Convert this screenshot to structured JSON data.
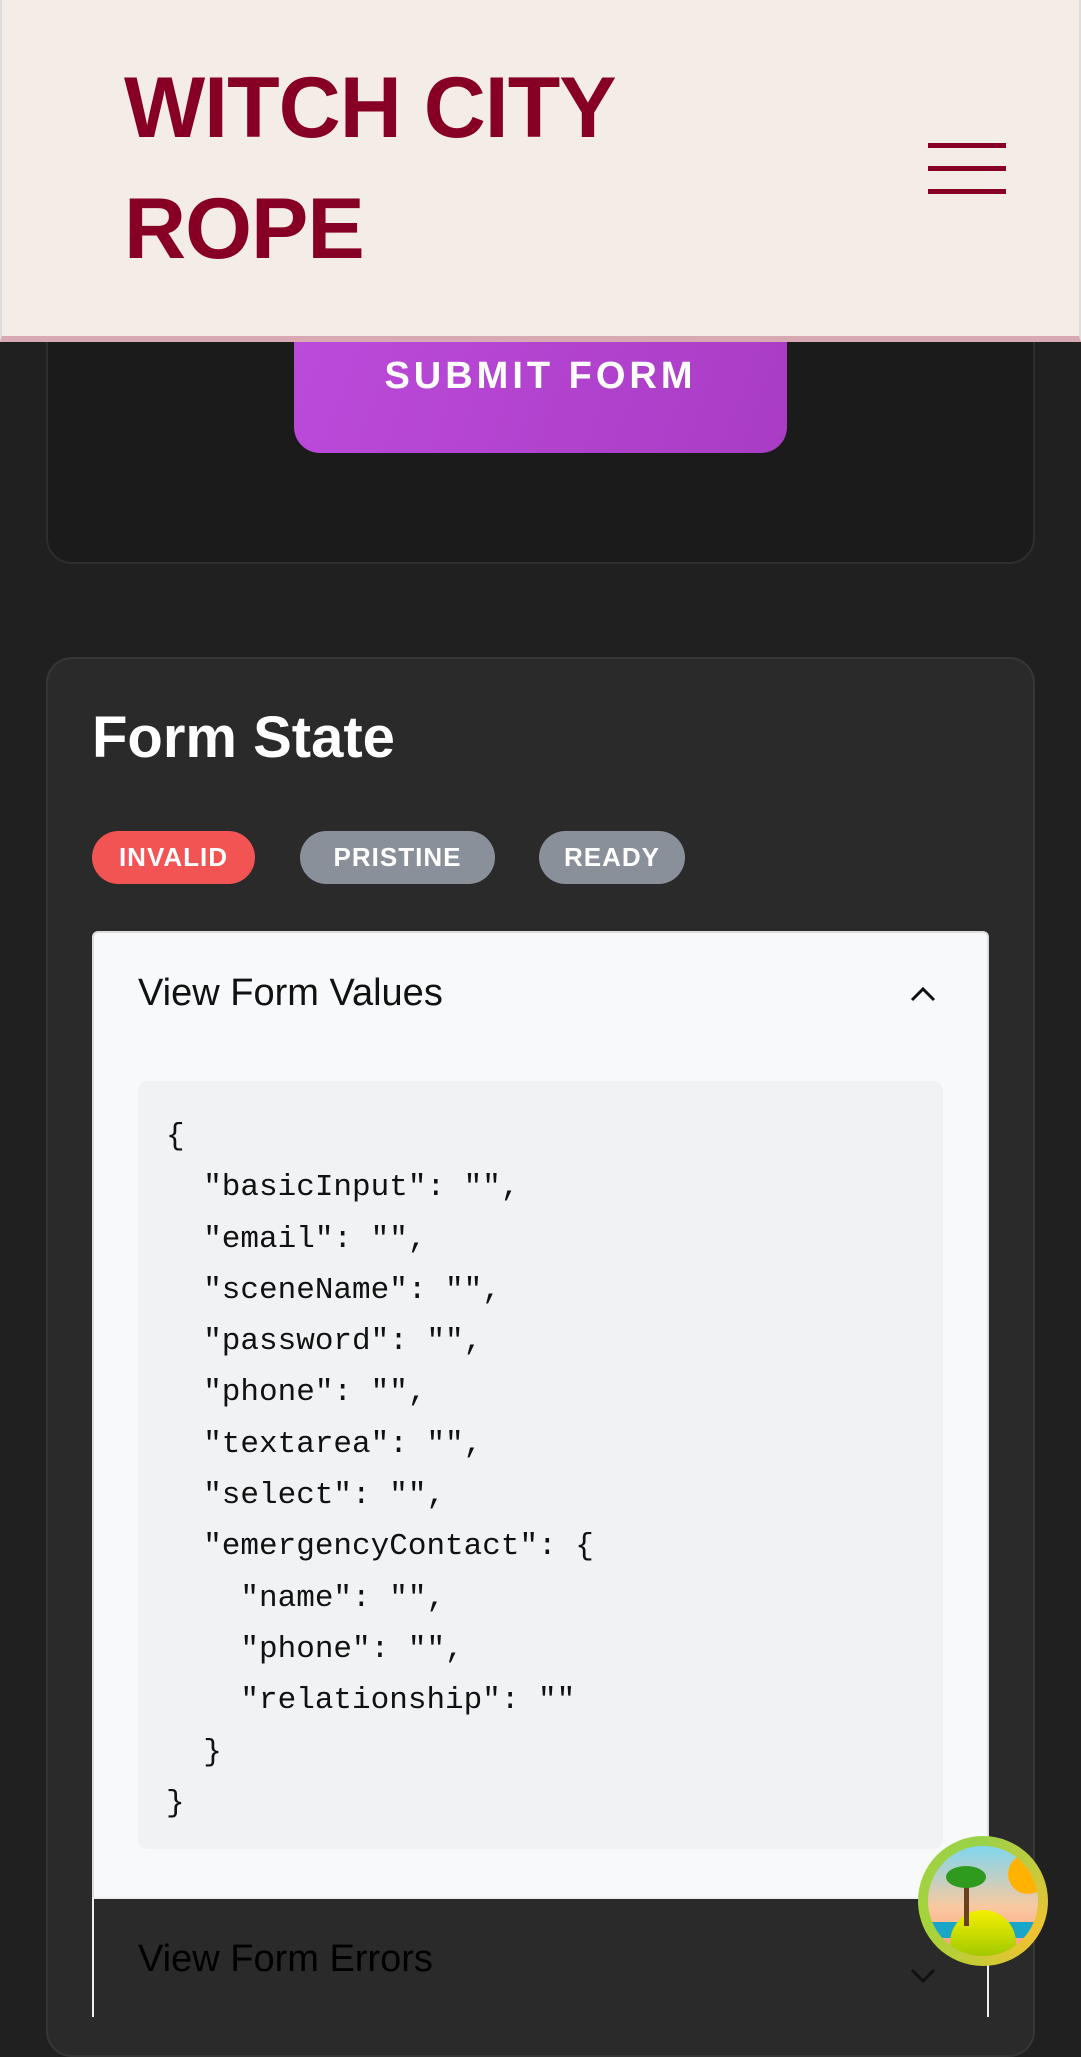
{
  "header": {
    "logo": "WITCH CITY ROPE",
    "logo_line1": "WITCH CITY",
    "logo_line2": "ROPE"
  },
  "form": {
    "submit_label": "SUBMIT FORM"
  },
  "form_state": {
    "title": "Form State",
    "badges": [
      {
        "label": "INVALID",
        "color": "#f25454"
      },
      {
        "label": "PRISTINE",
        "color": "#8a9099"
      },
      {
        "label": "READY",
        "color": "#8a9099"
      }
    ],
    "values_panel": {
      "title": "View Form Values",
      "expanded": true,
      "code": "{\n  \"basicInput\": \"\",\n  \"email\": \"\",\n  \"sceneName\": \"\",\n  \"password\": \"\",\n  \"phone\": \"\",\n  \"textarea\": \"\",\n  \"select\": \"\",\n  \"emergencyContact\": {\n    \"name\": \"\",\n    \"phone\": \"\",\n    \"relationship\": \"\"\n  }\n}"
    },
    "errors_panel": {
      "title": "View Form Errors",
      "expanded": false
    }
  }
}
